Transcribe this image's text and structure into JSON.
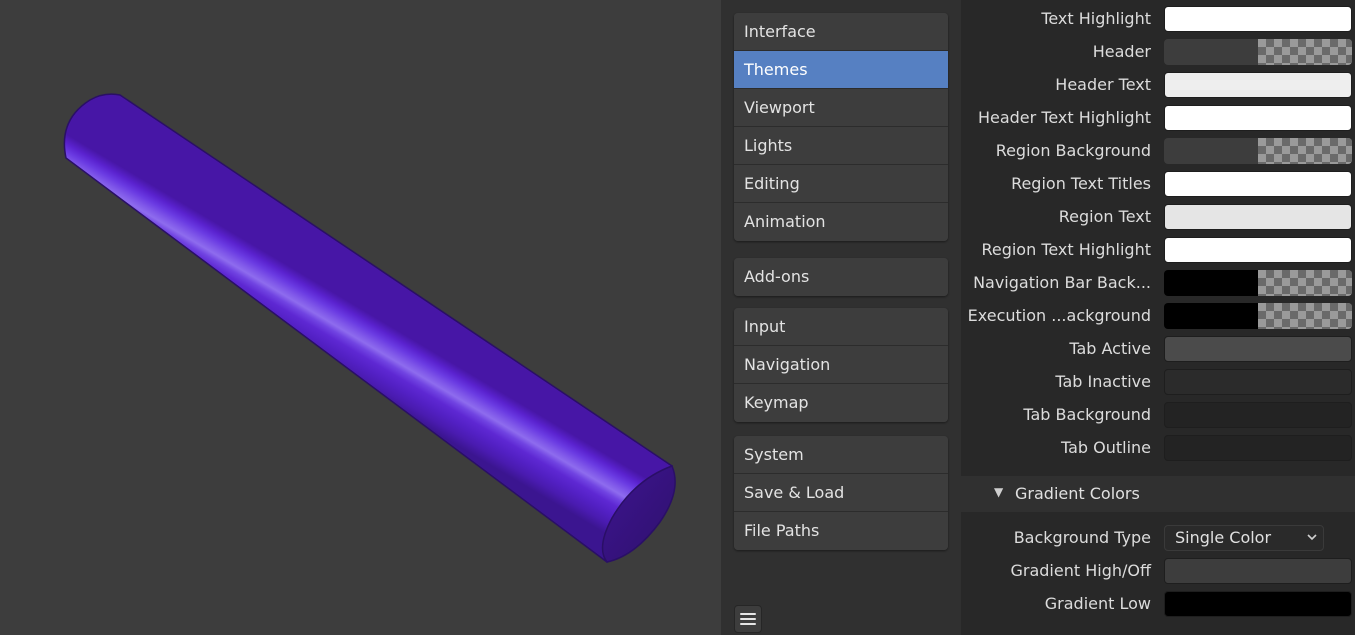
{
  "navigation": {
    "groups": [
      {
        "items": [
          {
            "label": "Interface",
            "active": false
          },
          {
            "label": "Themes",
            "active": true
          },
          {
            "label": "Viewport",
            "active": false
          },
          {
            "label": "Lights",
            "active": false
          },
          {
            "label": "Editing",
            "active": false
          },
          {
            "label": "Animation",
            "active": false
          }
        ]
      },
      {
        "items": [
          {
            "label": "Add-ons",
            "active": false
          }
        ]
      },
      {
        "items": [
          {
            "label": "Input",
            "active": false
          },
          {
            "label": "Navigation",
            "active": false
          },
          {
            "label": "Keymap",
            "active": false
          }
        ]
      },
      {
        "items": [
          {
            "label": "System",
            "active": false
          },
          {
            "label": "Save & Load",
            "active": false
          },
          {
            "label": "File Paths",
            "active": false
          }
        ]
      }
    ],
    "menu_icon": "hamburger-menu-icon"
  },
  "theme_colors": [
    {
      "label": "Text Highlight",
      "color": "#ffffff",
      "alpha": false
    },
    {
      "label": "Header",
      "color": "#3d3d3d",
      "alpha": true
    },
    {
      "label": "Header Text",
      "color": "#eeeeee",
      "alpha": false
    },
    {
      "label": "Header Text Highlight",
      "color": "#ffffff",
      "alpha": false
    },
    {
      "label": "Region Background",
      "color": "#3d3d3d",
      "alpha": true
    },
    {
      "label": "Region Text Titles",
      "color": "#ffffff",
      "alpha": false
    },
    {
      "label": "Region Text",
      "color": "#e5e5e5",
      "alpha": false
    },
    {
      "label": "Region Text Highlight",
      "color": "#ffffff",
      "alpha": false
    },
    {
      "label": "Navigation Bar Back...",
      "color": "#000000",
      "alpha": true
    },
    {
      "label": "Execution ...ackground",
      "color": "#000000",
      "alpha": true
    },
    {
      "label": "Tab Active",
      "color": "#4b4b4b",
      "alpha": false
    },
    {
      "label": "Tab Inactive",
      "color": "#2b2b2b",
      "alpha": false
    },
    {
      "label": "Tab Background",
      "color": "#232323",
      "alpha": false
    },
    {
      "label": "Tab Outline",
      "color": "#232323",
      "alpha": false
    }
  ],
  "gradient_section": {
    "title": "Gradient Colors",
    "expanded": true,
    "arrow_icon": "disclosure-triangle-down-icon",
    "background_type": {
      "label": "Background Type",
      "value": "Single Color"
    },
    "colors": [
      {
        "label": "Gradient High/Off",
        "color": "#3d3d3d",
        "alpha": false
      },
      {
        "label": "Gradient Low",
        "color": "#000000",
        "alpha": false
      }
    ]
  },
  "viewport_object": {
    "type": "cylinder",
    "color": "#5b1fd0"
  }
}
